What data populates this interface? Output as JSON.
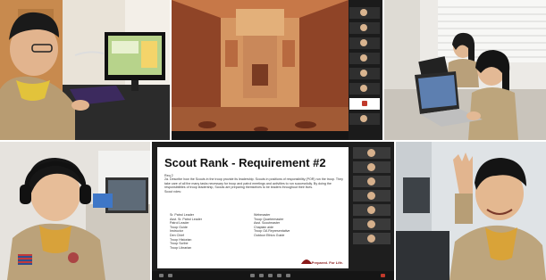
{
  "slide": {
    "title": "Scout Rank - Requirement #2",
    "req_label": "Req 2",
    "req_text": "2a. Describe how the Scouts in the troop provide its leadership. Scouts in positions of responsibility (POR) run the troop. They take care of all the many tasks necessary for troop and patrol meetings and activities to run successfully. By doing the responsibilities of troop leadership, Scouts are preparing themselves to be leaders throughout their lives.",
    "scout_roles_label": "Scout roles:",
    "ranks_left": [
      "Sr. Patrol Leader",
      "Asst. Sr. Patrol Leader",
      "Patrol Leader",
      "Troop Guide",
      "Instructor",
      "Den Chief",
      "Troop Historian",
      "Troop Scribe",
      "Troop Librarian"
    ],
    "ranks_right": [
      "Webmaster",
      "Troop Quartermaster",
      "Asst. Scoutmaster",
      "Chaplain aide",
      "Troop OA Representative",
      "Outdoor Ethics Guide"
    ],
    "footer": "Prepared. For Life."
  }
}
